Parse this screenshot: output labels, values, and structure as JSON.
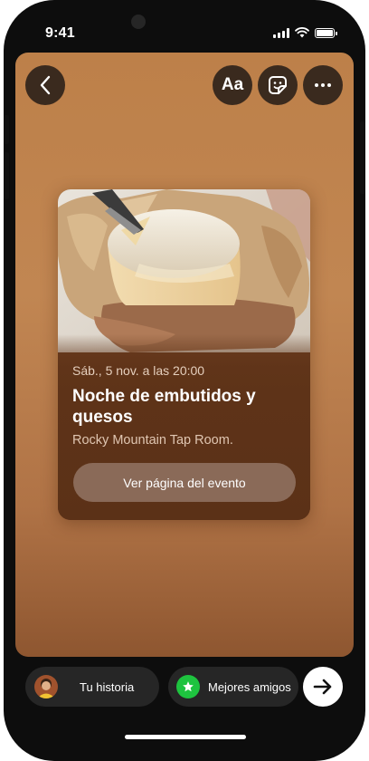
{
  "status": {
    "time": "9:41"
  },
  "toolbar": {
    "text_label": "Aa"
  },
  "event": {
    "date": "Sáb., 5 nov. a las 20:00",
    "title": "Noche de embutidos y quesos",
    "place": "Rocky Mountain Tap Room.",
    "button_label": "Ver página del evento"
  },
  "share": {
    "story_label": "Tu historia",
    "friends_label": "Mejores amigos"
  },
  "icons": {
    "back": "chevron-left-icon",
    "sticker": "sticker-icon",
    "more": "more-horizontal-icon",
    "star": "star-icon",
    "next": "arrow-right-icon"
  },
  "colors": {
    "story_bg": "#c18652",
    "card_bg": "#5e3318",
    "best_friends_green": "#1ec33f",
    "pill_bg": "#262626"
  }
}
